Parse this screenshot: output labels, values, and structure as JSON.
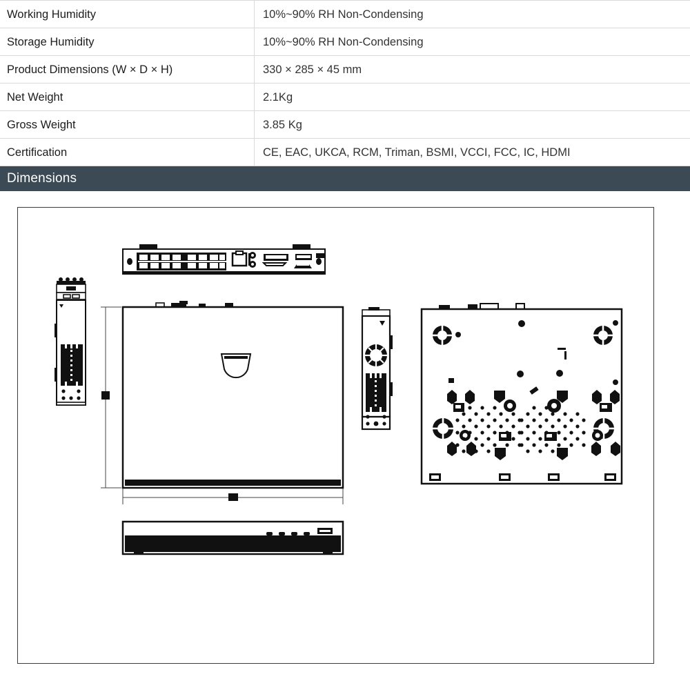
{
  "spec_table": {
    "rows": [
      {
        "label": "Working Humidity",
        "value": "10%~90% RH Non-Condensing"
      },
      {
        "label": "Storage Humidity",
        "value": "10%~90% RH Non-Condensing"
      },
      {
        "label": "Product Dimensions (W × D ×  H)",
        "value": "330 × 285 × 45 mm"
      },
      {
        "label": "Net Weight",
        "value": "2.1Kg"
      },
      {
        "label": "Gross Weight",
        "value": "3.85 Kg"
      },
      {
        "label": "Certification",
        "value": "CE, EAC, UKCA, RCM, Triman, BSMI, VCCI, FCC, IC, HDMI"
      }
    ]
  },
  "section": {
    "title": "Dimensions",
    "band_color": "#3c4a55"
  },
  "dimension_drawing": {
    "panel_border_color": "#3a3a3a",
    "views": [
      {
        "name": "rear-panel-view",
        "description": "Rear panel with 8 PoE RJ45 ports, LAN port, audio jacks, VGA, HDMI, USB and power connector"
      },
      {
        "name": "left-side-view",
        "description": "Narrow left side profile with ventilation grille and base screw holes"
      },
      {
        "name": "top-view",
        "description": "Top view of chassis with centre emblem and width/depth dimension lines"
      },
      {
        "name": "right-side-view",
        "description": "Right side profile with circular fan vent and ventilation grille"
      },
      {
        "name": "bottom-view",
        "description": "Bottom plate with rubber feet, mounting posts and two ventilation hole clusters"
      },
      {
        "name": "front-view",
        "description": "Front panel with LED indicators and front USB port"
      }
    ]
  }
}
